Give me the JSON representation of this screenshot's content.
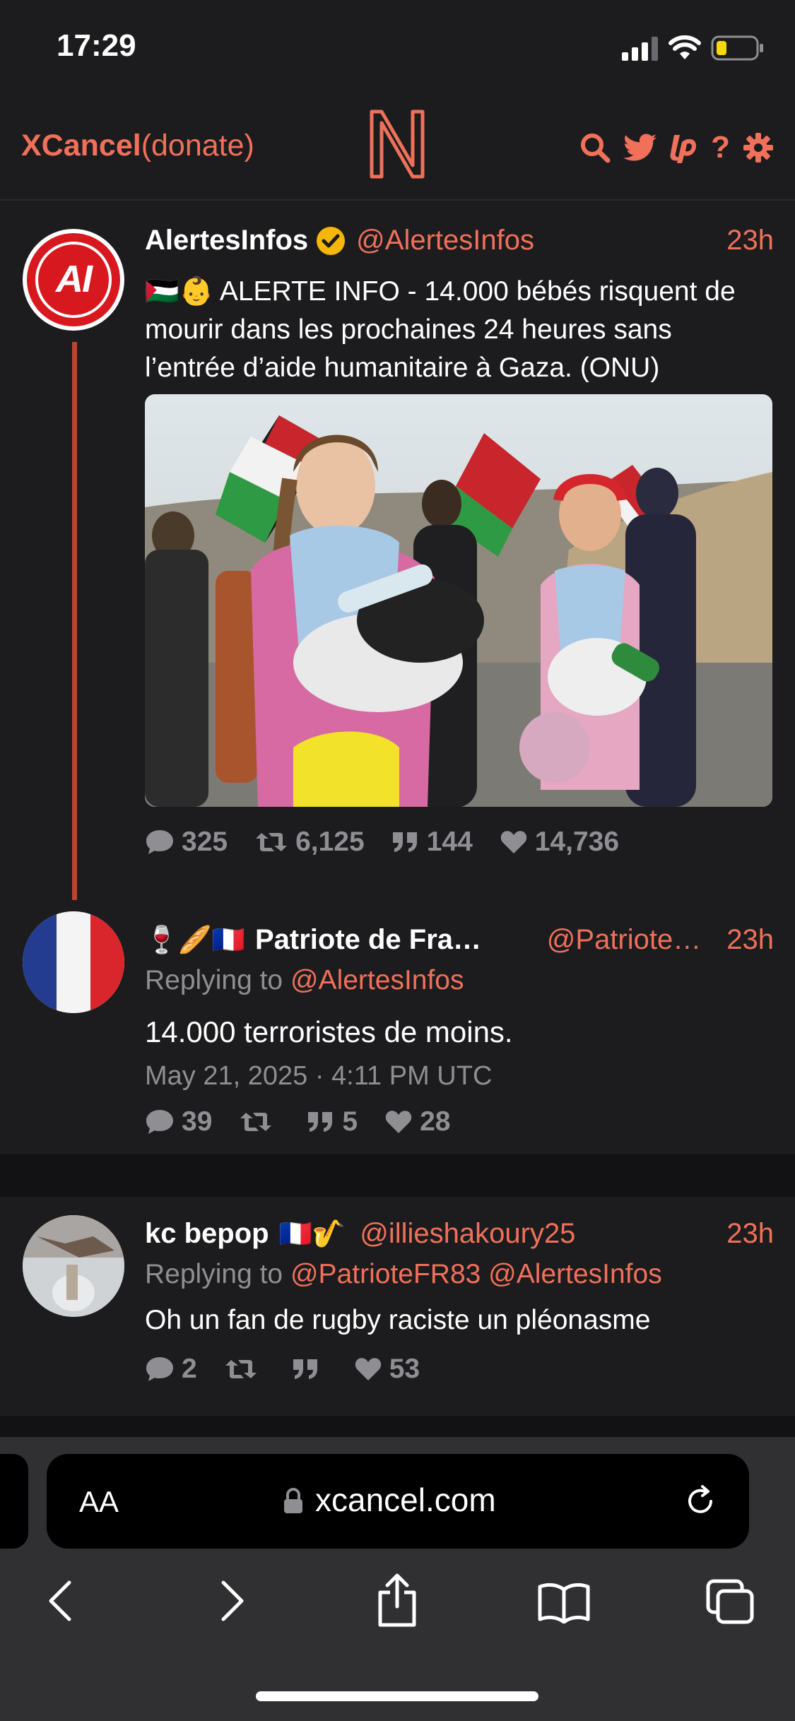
{
  "status_bar": {
    "time": "17:29"
  },
  "header": {
    "brand_name": "XCancel",
    "donate_label": "(donate)",
    "logo_letter": "N",
    "icons": [
      "search-icon",
      "twitter-bird-icon",
      "liberapay-icon",
      "help-icon",
      "settings-gear-icon"
    ],
    "help_label": "?"
  },
  "colors": {
    "accent": "#f0705a",
    "background": "#1c1c1e",
    "muted": "#8e8e93",
    "thread_line": "#c0432f"
  },
  "tweets": [
    {
      "name": "AlertesInfos",
      "handle": "@AlertesInfos",
      "time": "23h",
      "verified": true,
      "avatar_text": "AI",
      "emojis": "🇵🇸👶",
      "text": "ALERTE INFO - 14.000 bébés risquent de mourir dans les prochaines 24 heures sans l’entrée d’aide humanitaire à Gaza. (ONU)",
      "stats": {
        "replies": "325",
        "retweets": "6,125",
        "quotes": "144",
        "likes": "14,736"
      }
    },
    {
      "name_emojis": "🍷🥖🇫🇷",
      "name": "Patriote de Fra…",
      "handle": "@Patriote…",
      "time": "23h",
      "replying_prefix": "Replying to",
      "replying_to": "@AlertesInfos",
      "text": "14.000 terroristes de moins.",
      "date": "May 21, 2025 · 4:11 PM UTC",
      "stats": {
        "replies": "39",
        "retweets": "",
        "quotes": "5",
        "likes": "28"
      }
    },
    {
      "name": "kc bepop",
      "name_emojis": "🇫🇷🎷",
      "handle": "@illieshakoury25",
      "time": "23h",
      "replying_prefix": "Replying to",
      "replying_to": "@PatrioteFR83 @AlertesInfos",
      "text": "Oh un fan de rugby raciste un pléonasme",
      "stats": {
        "replies": "2",
        "retweets": "",
        "quotes": "",
        "likes": "53"
      }
    }
  ],
  "browser": {
    "text_size_label": "AA",
    "url": "xcancel.com"
  }
}
